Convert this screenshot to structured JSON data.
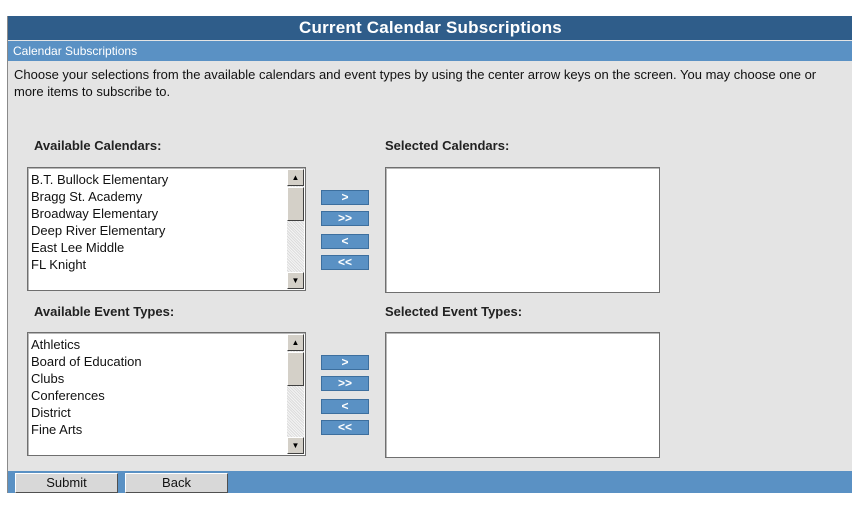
{
  "header": {
    "title": "Current Calendar Subscriptions"
  },
  "section": {
    "title": "Calendar Subscriptions"
  },
  "instructions": "Choose your selections from the available calendars and event types by using the center arrow keys on the screen. You may choose one or more items to subscribe to.",
  "calendars": {
    "available_label": "Available Calendars:",
    "selected_label": "Selected Calendars:",
    "available": [
      "B.T. Bullock Elementary",
      "Bragg St. Academy",
      "Broadway Elementary",
      "Deep River Elementary",
      "East Lee Middle",
      "FL Knight"
    ],
    "selected": []
  },
  "event_types": {
    "available_label": "Available Event Types:",
    "selected_label": "Selected Event Types:",
    "available": [
      "Athletics",
      "Board of Education",
      "Clubs",
      "Conferences",
      "District",
      "Fine Arts"
    ],
    "selected": []
  },
  "arrows": {
    "add": ">",
    "add_all": ">>",
    "remove": "<",
    "remove_all": "<<"
  },
  "footer": {
    "submit_label": "Submit",
    "back_label": "Back"
  },
  "scrollbar": {
    "up": "▲",
    "down": "▼"
  },
  "colors": {
    "title_bar": "#2f5d8a",
    "accent": "#5a91c4",
    "panel": "#e4e4e4"
  }
}
